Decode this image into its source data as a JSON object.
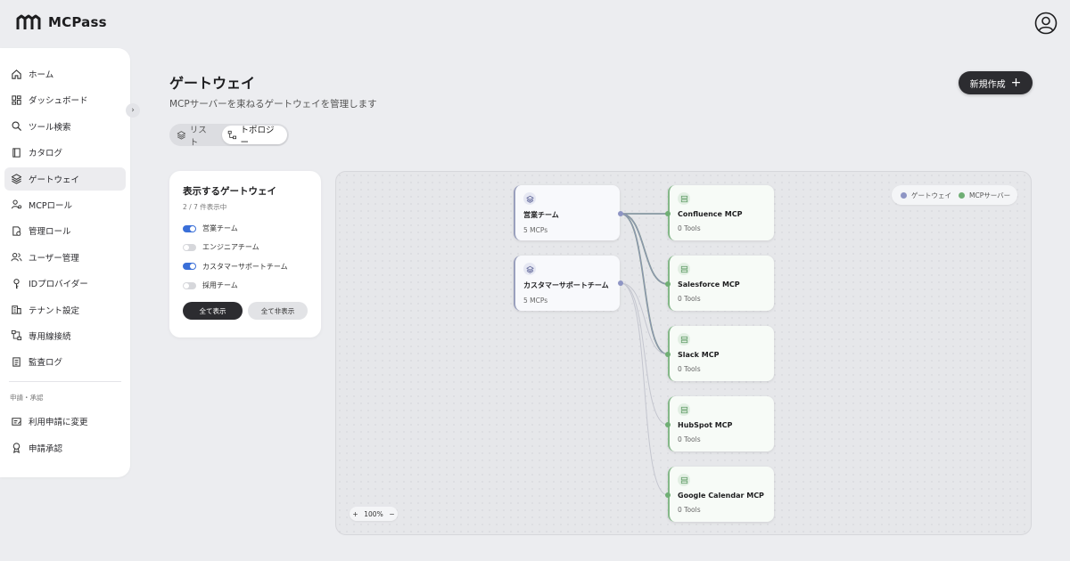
{
  "app": {
    "name": "MCPass"
  },
  "sidebar": {
    "items": [
      {
        "label": "ホーム",
        "icon": "home-icon"
      },
      {
        "label": "ダッシュボード",
        "icon": "dashboard-icon"
      },
      {
        "label": "ツール検索",
        "icon": "search-icon"
      },
      {
        "label": "カタログ",
        "icon": "book-icon"
      },
      {
        "label": "ゲートウェイ",
        "icon": "layers-icon",
        "active": true
      },
      {
        "label": "MCPロール",
        "icon": "user-role-icon"
      },
      {
        "label": "管理ロール",
        "icon": "admin-role-icon"
      },
      {
        "label": "ユーザー管理",
        "icon": "users-icon"
      },
      {
        "label": "IDプロバイダー",
        "icon": "key-icon"
      },
      {
        "label": "テナント設定",
        "icon": "building-icon"
      },
      {
        "label": "専用線接続",
        "icon": "network-icon"
      },
      {
        "label": "監査ログ",
        "icon": "log-icon"
      }
    ],
    "section_label": "申請・承認",
    "section_items": [
      {
        "label": "利用申請に変更",
        "icon": "request-icon"
      },
      {
        "label": "申請承認",
        "icon": "approval-icon"
      }
    ]
  },
  "page": {
    "title": "ゲートウェイ",
    "subtitle": "MCPサーバーを束ねるゲートウェイを管理します",
    "create_label": "新規作成",
    "view_list_label": "リスト",
    "view_topology_label": "トポロジー",
    "active_view": "topology"
  },
  "filter": {
    "title": "表示するゲートウェイ",
    "count": "2 / 7 件表示中",
    "items": [
      {
        "label": "営業チーム",
        "enabled": true
      },
      {
        "label": "エンジニアチーム",
        "enabled": false
      },
      {
        "label": "カスタマーサポートチーム",
        "enabled": true
      },
      {
        "label": "採用チーム",
        "enabled": false
      }
    ],
    "show_all_label": "全て表示",
    "hide_all_label": "全て非表示"
  },
  "topology": {
    "legend": {
      "gateway_label": "ゲートウェイ",
      "server_label": "MCPサーバー",
      "gateway_color": "#8e95c4",
      "server_color": "#6fae74"
    },
    "gateways": [
      {
        "name": "営業チーム",
        "meta": "5 MCPs"
      },
      {
        "name": "カスタマーサポートチーム",
        "meta": "5 MCPs"
      }
    ],
    "servers": [
      {
        "name": "Confluence MCP",
        "meta": "0 Tools"
      },
      {
        "name": "Salesforce MCP",
        "meta": "0 Tools"
      },
      {
        "name": "Slack MCP",
        "meta": "0 Tools"
      },
      {
        "name": "HubSpot MCP",
        "meta": "0 Tools"
      },
      {
        "name": "Google Calendar MCP",
        "meta": "0 Tools"
      }
    ],
    "zoom": {
      "plus": "+",
      "value": "100%",
      "minus": "−"
    }
  }
}
